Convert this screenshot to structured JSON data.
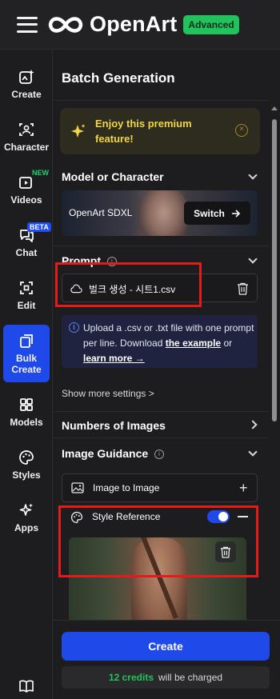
{
  "app": {
    "name": "OpenArt",
    "plan_badge": "Advanced"
  },
  "sidebar": {
    "items": [
      {
        "label": "Create",
        "icon": "sparkle-image-icon"
      },
      {
        "label": "Character",
        "icon": "face-scan-icon"
      },
      {
        "label": "Videos",
        "icon": "video-play-icon",
        "tag": "NEW"
      },
      {
        "label": "Chat",
        "icon": "chat-bubble-icon",
        "tag": "BETA"
      },
      {
        "label": "Edit",
        "icon": "edit-frame-icon"
      },
      {
        "label": "Bulk Create",
        "icon": "stack-icon",
        "active": true
      },
      {
        "label": "Models",
        "icon": "grid-icon"
      },
      {
        "label": "Styles",
        "icon": "palette-icon"
      },
      {
        "label": "Apps",
        "icon": "sparkles-icon"
      }
    ],
    "bottom_icon": "book-icon"
  },
  "panel": {
    "title": "Batch Generation",
    "premium": {
      "text": "Enjoy this premium feature!"
    },
    "model": {
      "heading": "Model or Character",
      "name": "OpenArt SDXL",
      "switch_label": "Switch"
    },
    "prompt": {
      "heading": "Prompt",
      "file_name": "벌크 생성 - 시트1.csv",
      "info": {
        "text_before": "Upload a .csv or .txt file with one prompt per line. Download ",
        "link1": "the example",
        "text_mid": " or ",
        "link2": "learn more →"
      }
    },
    "show_more": "Show more settings >",
    "numbers": {
      "heading": "Numbers of Images"
    },
    "guidance": {
      "heading": "Image Guidance",
      "image_to_image": "Image to Image",
      "style_reference": "Style Reference",
      "style_reference_enabled": true
    }
  },
  "footer": {
    "create_label": "Create",
    "credits_amount": "12 credits",
    "credits_suffix": "will be charged"
  },
  "colors": {
    "accent": "#1f49e8",
    "success": "#21c35c",
    "premium": "#f2d643",
    "highlight": "#e21b1b"
  }
}
